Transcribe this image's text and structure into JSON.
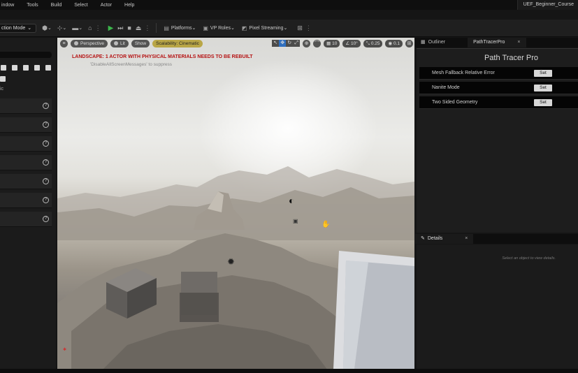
{
  "menu": {
    "items": [
      "indow",
      "Tools",
      "Build",
      "Select",
      "Actor",
      "Help"
    ],
    "project": "UEF_Beginner_Course"
  },
  "toolbar": {
    "mode": "ction Mode",
    "platforms": "Platforms",
    "vp_roles": "VP Roles",
    "pixel_streaming": "Pixel Streaming"
  },
  "left_panel": {
    "label": "ic",
    "row_count": 7
  },
  "viewport": {
    "perspective": "Perspective",
    "lit": "Lit",
    "show": "Show",
    "scalability": "Scalability: Cinematic",
    "grid_value": "10",
    "angle_value": "10°",
    "scale_value": "0.25",
    "camera_speed": "0.1",
    "warning": "LANDSCAPE: 1 ACTOR WITH PHYSICAL MATERIALS NEEDS TO BE REBUILT",
    "suppress": "'DisableAllScreenMessages' to suppress"
  },
  "right_panel": {
    "tabs": {
      "outliner": "Outliner",
      "path_tracer": "PathTracerPro",
      "close": "×"
    },
    "title": "Path Tracer Pro",
    "rows": [
      {
        "label": "Mesh Fallback Relative Error",
        "button": "Set"
      },
      {
        "label": "Nanite Mode",
        "button": "Set"
      },
      {
        "label": "Two Sided Geometry",
        "button": "Set"
      }
    ],
    "details_tab": "Details",
    "details_empty": "Select an object to view details."
  },
  "colors": {
    "accent_green": "#3bb64b",
    "warning_red": "#b51212",
    "scalability_bg": "#b9a646",
    "active_tool_blue": "#2f6fbf"
  }
}
